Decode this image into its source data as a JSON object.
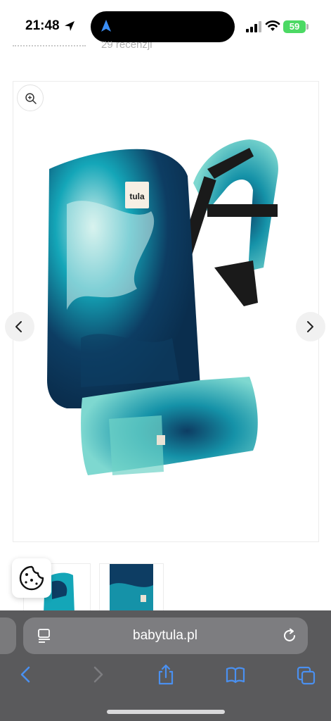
{
  "status_bar": {
    "time": "21:48",
    "battery": "59"
  },
  "page": {
    "rating_count_text": "29 recenzji"
  },
  "product": {
    "brand_label": "tula",
    "thumbnail_count": 2
  },
  "browser": {
    "url": "babytula.pl"
  },
  "colors": {
    "browser_bar": "#5a5a5c",
    "address_pill": "#7d7d80",
    "toolbar_icon": "#4a90f0",
    "battery": "#4cd964",
    "carrier_dark": "#0d3d63",
    "carrier_teal": "#14a6b8",
    "carrier_light": "#d8f3ee"
  },
  "icons": [
    "location-arrow-icon",
    "navigation-icon",
    "signal-icon",
    "wifi-icon",
    "battery-icon",
    "zoom-icon",
    "chevron-left-icon",
    "chevron-right-icon",
    "cookie-icon",
    "page-menu-icon",
    "reload-icon",
    "back-icon",
    "forward-icon",
    "share-icon",
    "bookmarks-icon",
    "tabs-icon"
  ]
}
